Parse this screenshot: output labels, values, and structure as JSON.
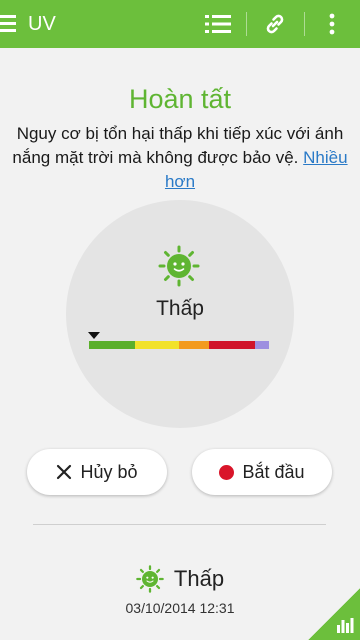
{
  "appbar": {
    "title": "UV",
    "color": "#6cbf3c",
    "icons": [
      "menu-icon",
      "list-icon",
      "link-icon",
      "overflow-icon"
    ]
  },
  "main": {
    "heading": "Hoàn tất",
    "description": "Nguy cơ bị tổn hại thấp khi tiếp xúc với ánh nắng mặt trời mà không được bảo vệ.",
    "more_link": "Nhiều hơn",
    "level_label": "Thấp",
    "level_fraction": 0.03,
    "scale_colors": [
      "#5aaf2b",
      "#f2e22a",
      "#f39a1e",
      "#d0142a",
      "#9d8fe0"
    ]
  },
  "buttons": {
    "cancel_label": "Hủy bỏ",
    "start_label": "Bắt đầu"
  },
  "history": {
    "level_label": "Thấp",
    "timestamp": "03/10/2014 12:31"
  },
  "accent_green": "#5fb532",
  "record_red": "#d9152a"
}
